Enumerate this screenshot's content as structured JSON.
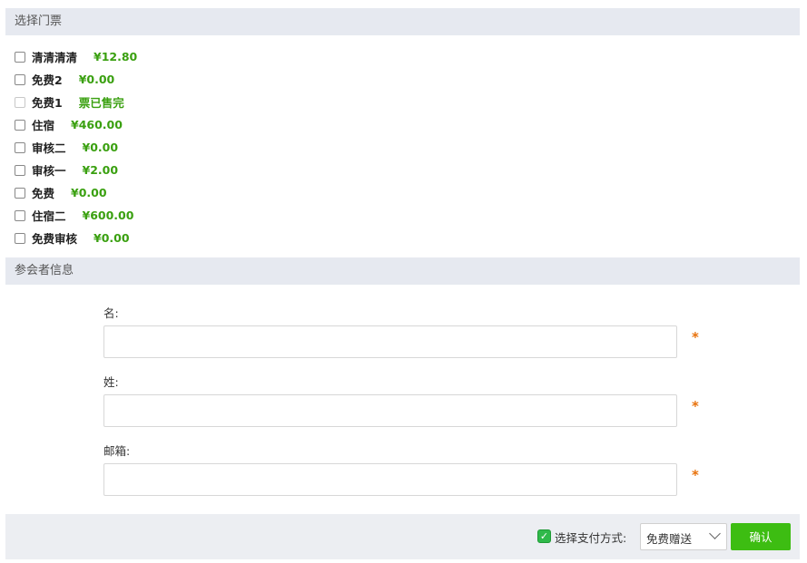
{
  "sections": {
    "tickets_title": "选择门票",
    "attendee_title": "参会者信息"
  },
  "tickets": [
    {
      "name": "清清清清",
      "price": "¥12.80",
      "disabled": false
    },
    {
      "name": "免费2",
      "price": "¥0.00",
      "disabled": false
    },
    {
      "name": "免费1",
      "price": "票已售完",
      "disabled": true
    },
    {
      "name": "住宿",
      "price": "¥460.00",
      "disabled": false
    },
    {
      "name": "审核二",
      "price": "¥0.00",
      "disabled": false
    },
    {
      "name": "审核一",
      "price": "¥2.00",
      "disabled": false
    },
    {
      "name": "免费",
      "price": "¥0.00",
      "disabled": false
    },
    {
      "name": "住宿二",
      "price": "¥600.00",
      "disabled": false
    },
    {
      "name": "免费审核",
      "price": "¥0.00",
      "disabled": false
    }
  ],
  "form": {
    "first_name_label": "名:",
    "first_name_value": "",
    "last_name_label": "姓:",
    "last_name_value": "",
    "email_label": "邮箱:",
    "email_value": "",
    "required_mark": "*"
  },
  "footer": {
    "check_glyph": "✓",
    "payment_label": "选择支付方式:",
    "payment_selected": "免费赠送",
    "confirm_label": "确认"
  },
  "colors": {
    "price_green": "#3aa010",
    "required_orange": "#e8710a",
    "confirm_green": "#3dbd12",
    "section_bar": "#e6e9f0"
  }
}
